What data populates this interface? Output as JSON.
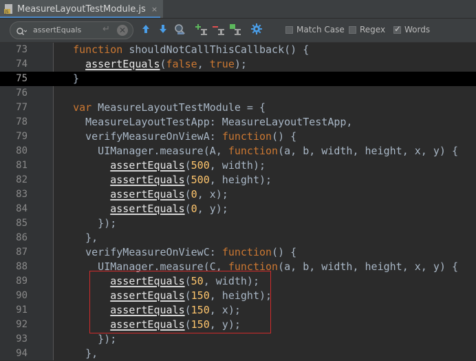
{
  "tab": {
    "title": "MeasureLayoutTestModule.js",
    "close": "×",
    "icon": "javascript-file-icon"
  },
  "search": {
    "value": "assertEquals",
    "enter_glyph": "↵",
    "clear_glyph": "✕",
    "options": [
      {
        "label": "Match Case",
        "checked": false
      },
      {
        "label": "Regex",
        "checked": false
      },
      {
        "label": "Words",
        "checked": true
      }
    ],
    "toolbar_icons": [
      "arrow-up-icon",
      "arrow-down-icon",
      "find-all-icon",
      "add-occurrence-icon",
      "remove-occurrence-icon",
      "select-all-occurrences-icon",
      "settings-icon"
    ]
  },
  "editor": {
    "current_line": 75,
    "lines": [
      {
        "n": "73",
        "text": "  function shouldNotCallThisCallback() {"
      },
      {
        "n": "74",
        "text": "    assertEquals(false, true);"
      },
      {
        "n": "75",
        "text": "  }"
      },
      {
        "n": "76",
        "text": ""
      },
      {
        "n": "77",
        "text": "  var MeasureLayoutTestModule = {"
      },
      {
        "n": "78",
        "text": "    MeasureLayoutTestApp: MeasureLayoutTestApp,"
      },
      {
        "n": "79",
        "text": "    verifyMeasureOnViewA: function() {"
      },
      {
        "n": "80",
        "text": "      UIManager.measure(A, function(a, b, width, height, x, y) {"
      },
      {
        "n": "81",
        "text": "        assertEquals(500, width);"
      },
      {
        "n": "82",
        "text": "        assertEquals(500, height);"
      },
      {
        "n": "83",
        "text": "        assertEquals(0, x);"
      },
      {
        "n": "84",
        "text": "        assertEquals(0, y);"
      },
      {
        "n": "85",
        "text": "      });"
      },
      {
        "n": "86",
        "text": "    },"
      },
      {
        "n": "87",
        "text": "    verifyMeasureOnViewC: function() {"
      },
      {
        "n": "88",
        "text": "      UIManager.measure(C, function(a, b, width, height, x, y) {"
      },
      {
        "n": "89",
        "text": "        assertEquals(50, width);"
      },
      {
        "n": "90",
        "text": "        assertEquals(150, height);"
      },
      {
        "n": "91",
        "text": "        assertEquals(150, x);"
      },
      {
        "n": "92",
        "text": "        assertEquals(150, y);"
      },
      {
        "n": "93",
        "text": "      });"
      },
      {
        "n": "94",
        "text": "    },"
      }
    ]
  },
  "colors": {
    "keyword": "#cc7832",
    "function_name": "#ffc66d",
    "number": "#6897bb",
    "default": "#a9b7c6",
    "highlight_box": "#d32b2b"
  }
}
